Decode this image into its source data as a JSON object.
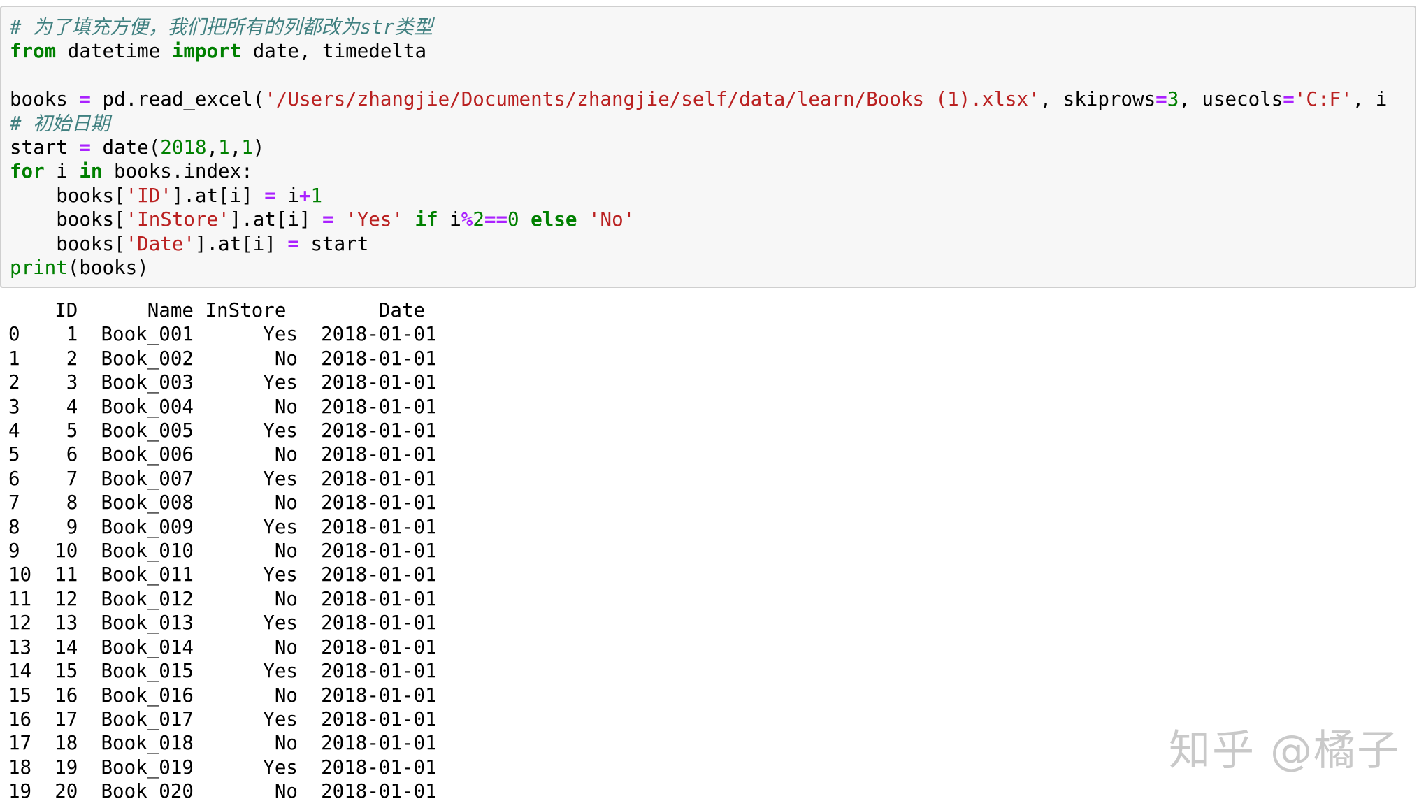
{
  "code_cell": {
    "comment_fill": "# 为了填充方便，我们把所有的列都改为str类型",
    "import_from": "from",
    "import_module": "datetime",
    "import_kw": "import",
    "import_names": "date, timedelta",
    "read_var": "books",
    "read_eq": "=",
    "read_call": "pd.read_excel(",
    "read_path": "'/Users/zhangjie/Documents/zhangjie/self/data/learn/Books (1).xlsx'",
    "read_skip_kw": ", skiprows",
    "read_eq2": "=",
    "read_skip_val": "3",
    "read_usecols_kw": ", usecols",
    "read_eq3": "=",
    "read_usecols_val": "'C:F'",
    "read_tail": ", i",
    "comment_start": "# 初始日期",
    "start_var": "start",
    "start_eq": "=",
    "start_call": "date(",
    "start_y": "2018",
    "start_m": "1",
    "start_d": "1",
    "start_close": ")",
    "for_kw": "for",
    "for_var": " i ",
    "in_kw": "in",
    "for_iter": " books.index:",
    "l1_pre": "    books[",
    "l1_key": "'ID'",
    "l1_mid": "].at[i] ",
    "l1_eq": "=",
    "l1_rhs": " i",
    "l1_plus": "+",
    "l1_num": "1",
    "l2_pre": "    books[",
    "l2_key": "'InStore'",
    "l2_mid": "].at[i] ",
    "l2_eq": "=",
    "l2_yes": "'Yes'",
    "l2_if": "if",
    "l2_i": " i",
    "l2_mod": "%",
    "l2_two": "2",
    "l2_eqeq": "==",
    "l2_zero": "0",
    "l2_else": "else",
    "l2_no": "'No'",
    "l3_pre": "    books[",
    "l3_key": "'Date'",
    "l3_mid": "].at[i] ",
    "l3_eq": "=",
    "l3_rhs": " start",
    "print_fn": "print",
    "print_arg": "(books)"
  },
  "output": {
    "columns": [
      "ID",
      "Name",
      "InStore",
      "Date"
    ],
    "rows": [
      {
        "index": "0",
        "id": "1",
        "name": "Book_001",
        "instore": "Yes",
        "date": "2018-01-01"
      },
      {
        "index": "1",
        "id": "2",
        "name": "Book_002",
        "instore": "No",
        "date": "2018-01-01"
      },
      {
        "index": "2",
        "id": "3",
        "name": "Book_003",
        "instore": "Yes",
        "date": "2018-01-01"
      },
      {
        "index": "3",
        "id": "4",
        "name": "Book_004",
        "instore": "No",
        "date": "2018-01-01"
      },
      {
        "index": "4",
        "id": "5",
        "name": "Book_005",
        "instore": "Yes",
        "date": "2018-01-01"
      },
      {
        "index": "5",
        "id": "6",
        "name": "Book_006",
        "instore": "No",
        "date": "2018-01-01"
      },
      {
        "index": "6",
        "id": "7",
        "name": "Book_007",
        "instore": "Yes",
        "date": "2018-01-01"
      },
      {
        "index": "7",
        "id": "8",
        "name": "Book_008",
        "instore": "No",
        "date": "2018-01-01"
      },
      {
        "index": "8",
        "id": "9",
        "name": "Book_009",
        "instore": "Yes",
        "date": "2018-01-01"
      },
      {
        "index": "9",
        "id": "10",
        "name": "Book_010",
        "instore": "No",
        "date": "2018-01-01"
      },
      {
        "index": "10",
        "id": "11",
        "name": "Book_011",
        "instore": "Yes",
        "date": "2018-01-01"
      },
      {
        "index": "11",
        "id": "12",
        "name": "Book_012",
        "instore": "No",
        "date": "2018-01-01"
      },
      {
        "index": "12",
        "id": "13",
        "name": "Book_013",
        "instore": "Yes",
        "date": "2018-01-01"
      },
      {
        "index": "13",
        "id": "14",
        "name": "Book_014",
        "instore": "No",
        "date": "2018-01-01"
      },
      {
        "index": "14",
        "id": "15",
        "name": "Book_015",
        "instore": "Yes",
        "date": "2018-01-01"
      },
      {
        "index": "15",
        "id": "16",
        "name": "Book_016",
        "instore": "No",
        "date": "2018-01-01"
      },
      {
        "index": "16",
        "id": "17",
        "name": "Book_017",
        "instore": "Yes",
        "date": "2018-01-01"
      },
      {
        "index": "17",
        "id": "18",
        "name": "Book_018",
        "instore": "No",
        "date": "2018-01-01"
      },
      {
        "index": "18",
        "id": "19",
        "name": "Book_019",
        "instore": "Yes",
        "date": "2018-01-01"
      },
      {
        "index": "19",
        "id": "20",
        "name": "Book_020",
        "instore": "No",
        "date": "2018-01-01"
      }
    ]
  },
  "watermark": "知乎 @橘子",
  "colors": {
    "cell_background": "#f7f7f7",
    "cell_border": "#cfcfcf",
    "comment": "#408080",
    "keyword": "#008000",
    "string": "#ba2121",
    "operator": "#aa22ff",
    "watermark": "#c9c9c9"
  }
}
